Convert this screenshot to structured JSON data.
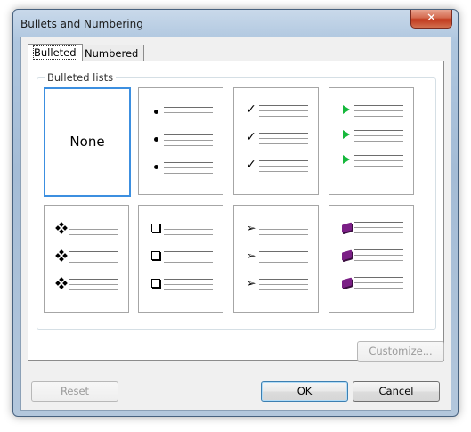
{
  "window": {
    "title": "Bullets and Numbering",
    "close_glyph": "✕"
  },
  "tabs": [
    {
      "label": "Bulleted",
      "active": true
    },
    {
      "label": "Numbered",
      "active": false
    }
  ],
  "group": {
    "label": "Bulleted lists"
  },
  "styles": [
    {
      "id": "none",
      "label": "None",
      "selected": true
    },
    {
      "id": "dot",
      "icon": "dot-bullet-icon"
    },
    {
      "id": "check",
      "icon": "check-bullet-icon",
      "glyph": "✓"
    },
    {
      "id": "triangle",
      "icon": "green-triangle-bullet-icon",
      "color": "#16b83c"
    },
    {
      "id": "diamond",
      "icon": "four-diamond-bullet-icon"
    },
    {
      "id": "box",
      "icon": "hollow-square-bullet-icon"
    },
    {
      "id": "arrow",
      "icon": "arrowhead-bullet-icon",
      "glyph": "➢"
    },
    {
      "id": "book",
      "icon": "book-bullet-icon",
      "color": "#7b1f86"
    }
  ],
  "buttons": {
    "customize": "Customize...",
    "reset": "Reset",
    "ok": "OK",
    "cancel": "Cancel"
  }
}
